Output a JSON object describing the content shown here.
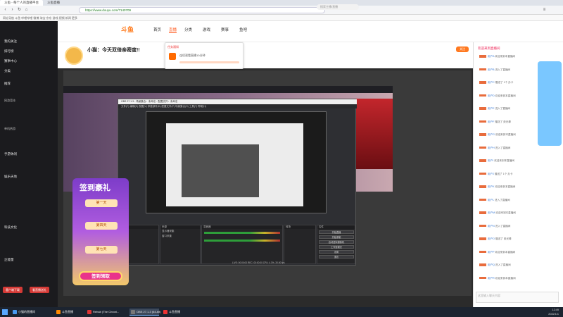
{
  "browser": {
    "tabs": [
      {
        "label": "斗鱼 - 每个人的直播平台"
      },
      {
        "label": "斗鱼直播"
      }
    ],
    "address": "https://www.douyu.com/7140709",
    "bookmarks": "网址导航  斗鱼  哔哩哔哩  微博  淘宝  京东  游戏  视频  新闻  更多"
  },
  "site": {
    "logo": "斗鱼",
    "nav": [
      "首页",
      "直播",
      "分类",
      "游戏",
      "赛事",
      "鱼吧",
      "下载"
    ],
    "active_nav": "直播",
    "search_placeholder": "搜索主播/直播"
  },
  "sidebar": {
    "sections": [
      {
        "label": "我的关注"
      },
      {
        "label": "排行榜"
      },
      {
        "label": "赛事中心"
      },
      {
        "label": "分类"
      },
      {
        "label": "推荐"
      },
      {
        "label": "网游竞技"
      },
      {
        "label": "单机热游"
      },
      {
        "label": "手游休闲"
      },
      {
        "label": "娱乐天地"
      },
      {
        "label": "科技文化"
      },
      {
        "label": "正能量"
      }
    ],
    "buttons": [
      "客户端下载",
      "看直播送礼"
    ]
  },
  "streamer": {
    "title": "小猫：今天双倍亲密度!!",
    "follow": "关注",
    "popup_title": "任务通知",
    "popup_text": "连续观看直播10分钟"
  },
  "obs": {
    "window_title": "OBS 27.1.3 - 场景集合：未命名 - 配置文件：未命名",
    "menus": "文件(F)  编辑(E)  视图(V)  停靠部件(D)  配置文件(P)  场景集合(S)  工具(T)  帮助(H)",
    "docks": [
      "场景",
      "来源",
      "混音器",
      "转场",
      "控件"
    ],
    "scene_item": "场景",
    "sources": [
      "显示器采集",
      "窗口采集"
    ],
    "controls": [
      "开始直播",
      "开始录制",
      "启动虚拟摄像机",
      "工作室模式",
      "设置",
      "退出"
    ],
    "status": "LIVE: 00:00:00   REC: 00:00:00   CPU: 4.3%, 30.00 fps"
  },
  "promo": {
    "title": "签到豪礼",
    "days": [
      "第一天",
      "第四天",
      "第七天"
    ],
    "button": "签到领取"
  },
  "chat": {
    "header": "欢迎来到直播间",
    "messages": [
      {
        "user": "用户A",
        "text": "欢迎来到本直播间"
      },
      {
        "user": "用户B",
        "text": "进入了直播间"
      },
      {
        "user": "用户C",
        "text": "赠送了 1个 办卡"
      },
      {
        "user": "用户D",
        "text": "欢迎来到本直播间"
      },
      {
        "user": "用户E",
        "text": "进入了直播间"
      },
      {
        "user": "用户F",
        "text": "赠送了 荧光棒"
      },
      {
        "user": "用户G",
        "text": "欢迎来到本直播间"
      },
      {
        "user": "用户H",
        "text": "进入了直播间"
      },
      {
        "user": "用户I",
        "text": "欢迎来到本直播间"
      },
      {
        "user": "用户J",
        "text": "赠送了 1个 办卡"
      },
      {
        "user": "用户K",
        "text": "欢迎来到本直播间"
      },
      {
        "user": "用户L",
        "text": "进入了直播间"
      },
      {
        "user": "用户M",
        "text": "欢迎来到本直播间"
      },
      {
        "user": "用户N",
        "text": "进入了直播间"
      },
      {
        "user": "用户O",
        "text": "赠送了 荧光棒"
      },
      {
        "user": "用户P",
        "text": "欢迎来到本直播间"
      },
      {
        "user": "用户Q",
        "text": "进入了直播间"
      },
      {
        "user": "用户R",
        "text": "欢迎来到本直播间"
      }
    ],
    "input_placeholder": "这里输入聊天内容"
  },
  "taskbar": {
    "tasks": [
      {
        "label": "小猫的直播间",
        "color": "#4a9af0"
      },
      {
        "label": "斗鱼直播",
        "color": "#ff8a00"
      },
      {
        "label": "Rehab (The Chroni...",
        "color": "#d33"
      },
      {
        "label": "OBS 27.1.3 (64-bit)",
        "color": "#777"
      },
      {
        "label": "斗鱼直播",
        "color": "#e33"
      }
    ],
    "time": "12:49",
    "date": "2022/1/1"
  }
}
